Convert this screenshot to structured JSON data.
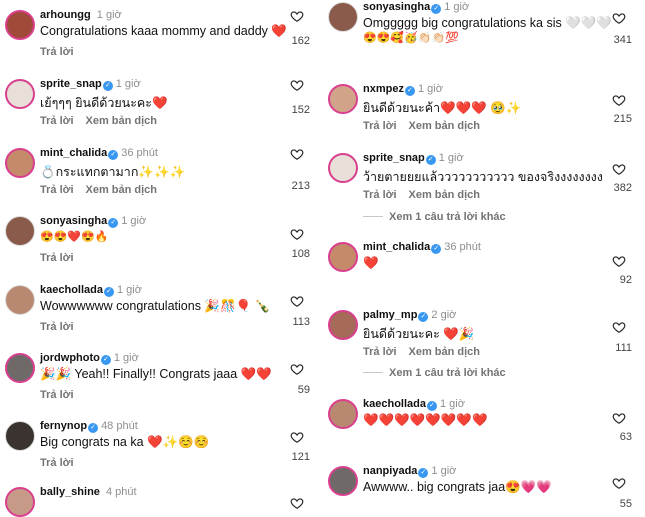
{
  "reply_label": "Trả lời",
  "translate_label": "Xem bản dịch",
  "left": [
    {
      "user": "arhoungg",
      "time": "1 giờ",
      "verified": false,
      "text": "Congratulations kaaa mommy and daddy ❤️",
      "likes": "162",
      "translate": false
    },
    {
      "user": "sprite_snap",
      "time": "1 giờ",
      "verified": true,
      "text": "เย้ๆๆๆ ยินดีด้วยนะคะ❤️",
      "likes": "152",
      "translate": true
    },
    {
      "user": "mint_chalida",
      "time": "36 phút",
      "verified": true,
      "text": "💍กระแทกตามาก✨✨✨",
      "likes": "213",
      "translate": true
    },
    {
      "user": "sonyasingha",
      "time": "1 giờ",
      "verified": true,
      "text": "😍😍❤️😍🔥",
      "likes": "108",
      "translate": false
    },
    {
      "user": "kaechollada",
      "time": "1 giờ",
      "verified": true,
      "text": "Wowwwwww congratulations 🎉🎊🎈 🍾",
      "likes": "113",
      "translate": false
    },
    {
      "user": "jordwphoto",
      "time": "1 giờ",
      "verified": true,
      "text": "🎉🎉 Yeah!! Finally!! Congrats jaaa ❤️❤️",
      "likes": "59",
      "translate": false
    },
    {
      "user": "fernynop",
      "time": "48 phút",
      "verified": true,
      "text": "Big congrats na ka ❤️✨☺️☺️",
      "likes": "121",
      "translate": false
    },
    {
      "user": "bally_shine",
      "time": "4 phút",
      "verified": false,
      "text": "",
      "likes": "",
      "translate": false
    }
  ],
  "right": [
    {
      "user": "sonyasingha",
      "time": "1 giờ",
      "verified": true,
      "text": "Omggggg big congratulations ka sis 🤍🤍🤍",
      "text2": "😍😍🥰🥳👏🏻👏🏻💯",
      "likes": "341",
      "translate": false
    },
    {
      "user": "nxmpez",
      "time": "1 giờ",
      "verified": true,
      "text": "ยินดีด้วยนะค้า❤️❤️❤️ 🥹✨",
      "likes": "215",
      "translate": true
    },
    {
      "user": "sprite_snap",
      "time": "1 giờ",
      "verified": true,
      "text": "ว้ายตายยยแล้ววววววววววว ของจริงงงงงงงง",
      "likes": "382",
      "translate": true,
      "more": "Xem 1 câu trả lời khác"
    },
    {
      "user": "mint_chalida",
      "time": "36 phút",
      "verified": true,
      "text": "❤️",
      "likes": "92",
      "translate": false
    },
    {
      "user": "palmy_mp",
      "time": "2 giờ",
      "verified": true,
      "text": "ยินดีด้วยนะคะ ❤️🎉",
      "likes": "111",
      "translate": true,
      "more": "Xem 1 câu trả lời khác"
    },
    {
      "user": "kaechollada",
      "time": "1 giờ",
      "verified": true,
      "text": "❤️❤️❤️❤️❤️❤️❤️❤️",
      "likes": "63",
      "translate": false
    },
    {
      "user": "nanpiyada",
      "time": "1 giờ",
      "verified": true,
      "text": "Awwww.. big congrats jaa😍💗💗",
      "likes": "55",
      "translate": false
    }
  ],
  "colors": {
    "verified": "#3897f0",
    "story_ring": "#d93f8f",
    "secondary_text": "#737373"
  }
}
